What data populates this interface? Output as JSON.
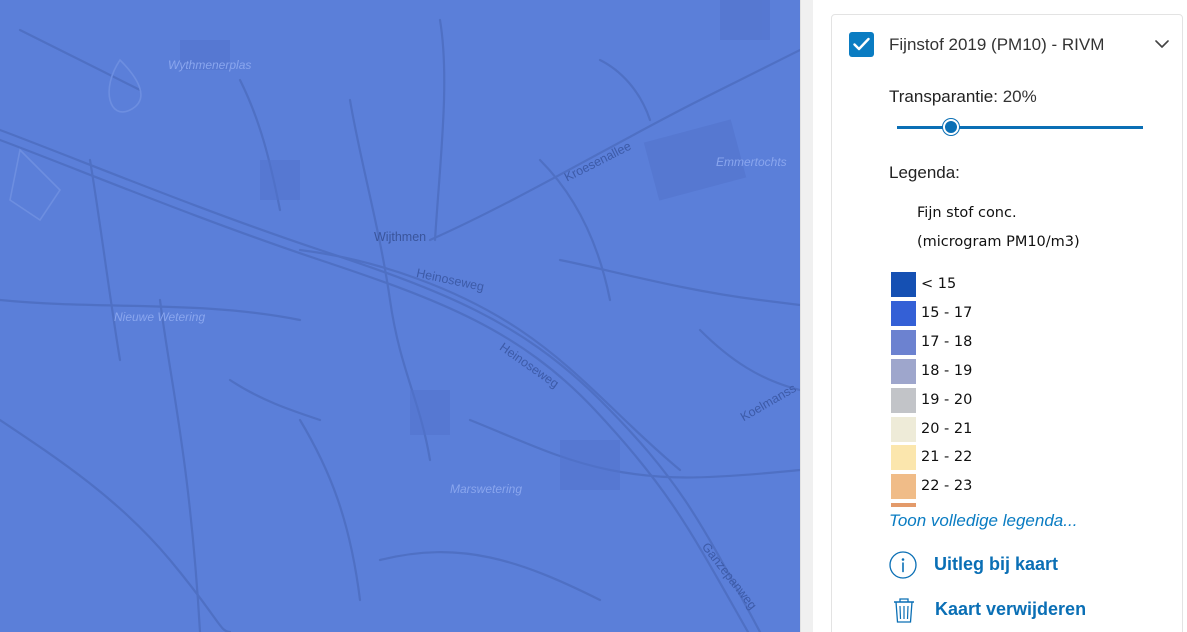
{
  "map": {
    "background_color": "#5b7fd9",
    "labels": {
      "wythmenerplas": "Wythmenerplas",
      "kroesenallee": "Kroesenallee",
      "emmertochtsloot": "Emmertochts",
      "wijthmen": "Wijthmen",
      "heinoseweg_1": "Heinoseweg",
      "heinoseweg_2": "Heinoseweg",
      "nieuwe_wetering": "Nieuwe Wetering",
      "marswetering": "Marswetering",
      "koelmansweg": "Koelmanss",
      "ganzepanweg": "Ganzepanweg"
    }
  },
  "layer": {
    "checked": true,
    "title": "Fijnstof 2019 (PM10) - RIVM",
    "transparency_label": "Transparantie:",
    "transparency_value": "20%",
    "transparency_percent": 20,
    "legend_label": "Legenda:",
    "legend": {
      "caption_line1": "Fijn stof conc.",
      "caption_line2": "(microgram PM10/m3)",
      "items": [
        {
          "label": "< 15",
          "color": "#1550b3"
        },
        {
          "label": "15 - 17",
          "color": "#3460d6"
        },
        {
          "label": "17 - 18",
          "color": "#6c82d0"
        },
        {
          "label": "18 - 19",
          "color": "#9ea6cc"
        },
        {
          "label": "19 - 20",
          "color": "#c2c4c8"
        },
        {
          "label": "20 - 21",
          "color": "#eeebd8"
        },
        {
          "label": "21 - 22",
          "color": "#fbe6ad"
        },
        {
          "label": "22 - 23",
          "color": "#f0bc88"
        }
      ],
      "next_color": "#e39a6a"
    },
    "more_legend_link": "Toon volledige legenda...",
    "info_action": "Uitleg bij kaart",
    "remove_action": "Kaart verwijderen",
    "accent_color": "#0a7cc2"
  }
}
